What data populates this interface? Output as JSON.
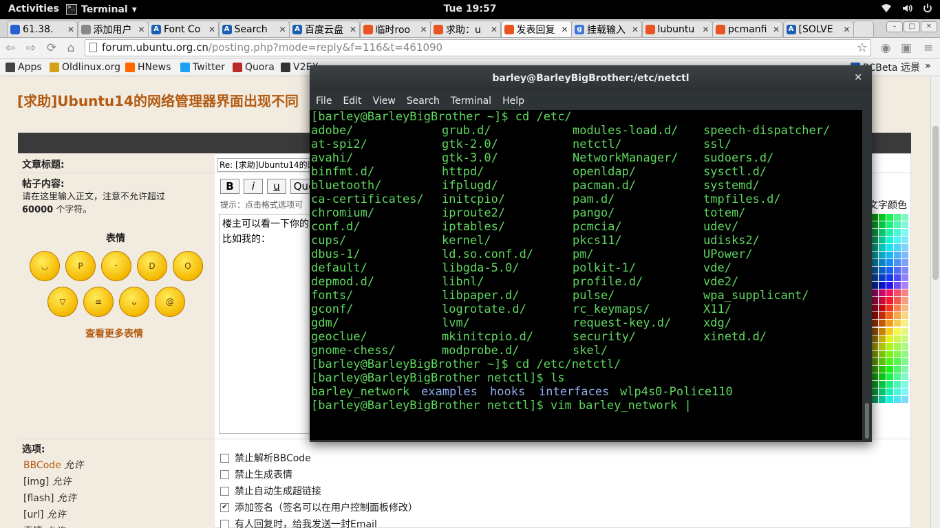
{
  "topbar": {
    "activities": "Activities",
    "app_name": "Terminal",
    "app_arrow": "▾",
    "clock": "Tue 19:57",
    "icons": [
      "wifi-icon",
      "volume-icon",
      "power-icon"
    ]
  },
  "tabs": [
    {
      "title": "61.38.",
      "fav": "paw",
      "fav_color": "#2b5fd1"
    },
    {
      "title": "添加用户",
      "fav": "page",
      "fav_color": "#888888"
    },
    {
      "title": "Font Co",
      "fav": "A",
      "fav_color": "#1a5fb4"
    },
    {
      "title": "Search",
      "fav": "A",
      "fav_color": "#1a5fb4"
    },
    {
      "title": "百度云盘",
      "fav": "A",
      "fav_color": "#1a5fb4"
    },
    {
      "title": "临时roo",
      "fav": "ubuntu",
      "fav_color": "#e95420"
    },
    {
      "title": "求助：u",
      "fav": "ubuntu",
      "fav_color": "#e95420"
    },
    {
      "title": "发表回复",
      "fav": "ubuntu",
      "fav_color": "#e95420"
    },
    {
      "title": "挂载输入",
      "fav": "g",
      "fav_color": "#3c78d8"
    },
    {
      "title": "lubuntu",
      "fav": "ubuntu",
      "fav_color": "#e95420"
    },
    {
      "title": "pcmanfi",
      "fav": "ubuntu",
      "fav_color": "#e95420"
    },
    {
      "title": "[SOLVE",
      "fav": "A",
      "fav_color": "#1a5fb4"
    }
  ],
  "address": {
    "host": "forum.ubuntu.org.cn",
    "path": "/posting.php?mode=reply&f=116&t=461090"
  },
  "bookmarks": [
    {
      "label": "Apps",
      "icon": "apps-icon",
      "color": "#444444"
    },
    {
      "label": "Oldlinux.org",
      "icon": "oldlinux-icon",
      "color": "#d4a017"
    },
    {
      "label": "HNews",
      "icon": "hnews-icon",
      "color": "#ff6600"
    },
    {
      "label": "Twitter",
      "icon": "twitter-icon",
      "color": "#1da1f2"
    },
    {
      "label": "Quora",
      "icon": "quora-icon",
      "color": "#b92b27"
    },
    {
      "label": "V2EX",
      "icon": "v2ex-icon",
      "color": "#333333"
    },
    {
      "label": "PCBeta 远景",
      "icon": "pcbeta-icon",
      "color": "#1a5fb4"
    }
  ],
  "page": {
    "title": "[求助]Ubuntu14的网络管理器界面出现不同",
    "subject_label": "文章标题:",
    "subject_value": "Re: [求助]Ubuntu14的网",
    "content_label": "帖子内容:",
    "content_hint1": "请在这里输入正文，注意不允许超过",
    "content_hint2_bold": "60000",
    "content_hint2_rest": " 个字符。",
    "emoji_title": "表情",
    "more_emoji": "查看更多表情",
    "format_buttons": [
      "B",
      "i",
      "u",
      "Quo"
    ],
    "format_hint": "提示：点击格式选项可",
    "textarea_text": "楼主可以看一下你的\n比如我的：",
    "color_label": "文字颜色",
    "options_label": "选项:",
    "left_options": [
      {
        "name": "BBCode",
        "state": "允许"
      },
      {
        "name": "[img]",
        "state": "允许"
      },
      {
        "name": "[flash]",
        "state": "允许"
      },
      {
        "name": "[url]",
        "state": "允许"
      },
      {
        "name": "表情",
        "state": "允许"
      }
    ],
    "checkboxes": [
      {
        "label": "禁止解析BBCode",
        "checked": false
      },
      {
        "label": "禁止生成表情",
        "checked": false
      },
      {
        "label": "禁止自动生成超链接",
        "checked": false
      },
      {
        "label": "添加签名（签名可以在用户控制面板修改）",
        "checked": true
      },
      {
        "label": "有人回复时，给我发送一封Email",
        "checked": false
      }
    ]
  },
  "terminal": {
    "title": "barley@BarleyBigBrother:/etc/netctl",
    "menu": [
      "File",
      "Edit",
      "View",
      "Search",
      "Terminal",
      "Help"
    ],
    "prompt1": "[barley@BarleyBigBrother ~]$ cd /etc/",
    "dirs": [
      [
        "adobe/",
        "grub.d/",
        "modules-load.d/",
        "speech-dispatcher/"
      ],
      [
        "at-spi2/",
        "gtk-2.0/",
        "netctl/",
        "ssl/"
      ],
      [
        "avahi/",
        "gtk-3.0/",
        "NetworkManager/",
        "sudoers.d/"
      ],
      [
        "binfmt.d/",
        "httpd/",
        "openldap/",
        "sysctl.d/"
      ],
      [
        "bluetooth/",
        "ifplugd/",
        "pacman.d/",
        "systemd/"
      ],
      [
        "ca-certificates/",
        "initcpio/",
        "pam.d/",
        "tmpfiles.d/"
      ],
      [
        "chromium/",
        "iproute2/",
        "pango/",
        "totem/"
      ],
      [
        "conf.d/",
        "iptables/",
        "pcmcia/",
        "udev/"
      ],
      [
        "cups/",
        "kernel/",
        "pkcs11/",
        "udisks2/"
      ],
      [
        "dbus-1/",
        "ld.so.conf.d/",
        "pm/",
        "UPower/"
      ],
      [
        "default/",
        "libgda-5.0/",
        "polkit-1/",
        "vde/"
      ],
      [
        "depmod.d/",
        "libnl/",
        "profile.d/",
        "vde2/"
      ],
      [
        "fonts/",
        "libpaper.d/",
        "pulse/",
        "wpa_supplicant/"
      ],
      [
        "gconf/",
        "logrotate.d/",
        "rc_keymaps/",
        "X11/"
      ],
      [
        "gdm/",
        "lvm/",
        "request-key.d/",
        "xdg/"
      ],
      [
        "geoclue/",
        "mkinitcpio.d/",
        "security/",
        "xinetd.d/"
      ],
      [
        "gnome-chess/",
        "modprobe.d/",
        "skel/",
        ""
      ]
    ],
    "prompt2": "[barley@BarleyBigBrother ~]$ cd /etc/netctl/",
    "prompt3": "[barley@BarleyBigBrother netctl]$ ls",
    "ls_items": [
      {
        "name": "barley_network",
        "kind": "file"
      },
      {
        "name": "examples",
        "kind": "dir"
      },
      {
        "name": "hooks",
        "kind": "dir"
      },
      {
        "name": "interfaces",
        "kind": "dir"
      },
      {
        "name": "wlp4s0-Police110",
        "kind": "file"
      }
    ],
    "prompt4": "[barley@BarleyBigBrother netctl]$ vim barley_network "
  }
}
